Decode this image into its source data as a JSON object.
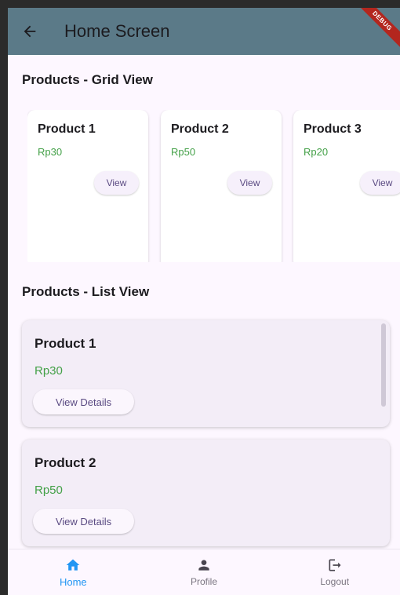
{
  "app_bar": {
    "title": "Home Screen",
    "back_icon": "arrow-back-icon",
    "debug_banner": "DEBUG",
    "background": "#5b7a88"
  },
  "grid_section": {
    "title": "Products - Grid View",
    "items": [
      {
        "name": "Product 1",
        "price": "Rp30",
        "button": "View"
      },
      {
        "name": "Product 2",
        "price": "Rp50",
        "button": "View"
      },
      {
        "name": "Product 3",
        "price": "Rp20",
        "button": "View"
      }
    ]
  },
  "list_section": {
    "title": "Products - List View",
    "items": [
      {
        "name": "Product 1",
        "price": "Rp30",
        "button": "View Details"
      },
      {
        "name": "Product 2",
        "price": "Rp50",
        "button": "View Details"
      }
    ]
  },
  "bottom_nav": {
    "items": [
      {
        "label": "Home",
        "icon": "home-icon",
        "active": true
      },
      {
        "label": "Profile",
        "icon": "person-icon",
        "active": false
      },
      {
        "label": "Logout",
        "icon": "logout-icon",
        "active": false
      }
    ]
  },
  "colors": {
    "price": "#43a047",
    "active_nav": "#2196f3",
    "debug_banner": "#b3261e"
  }
}
